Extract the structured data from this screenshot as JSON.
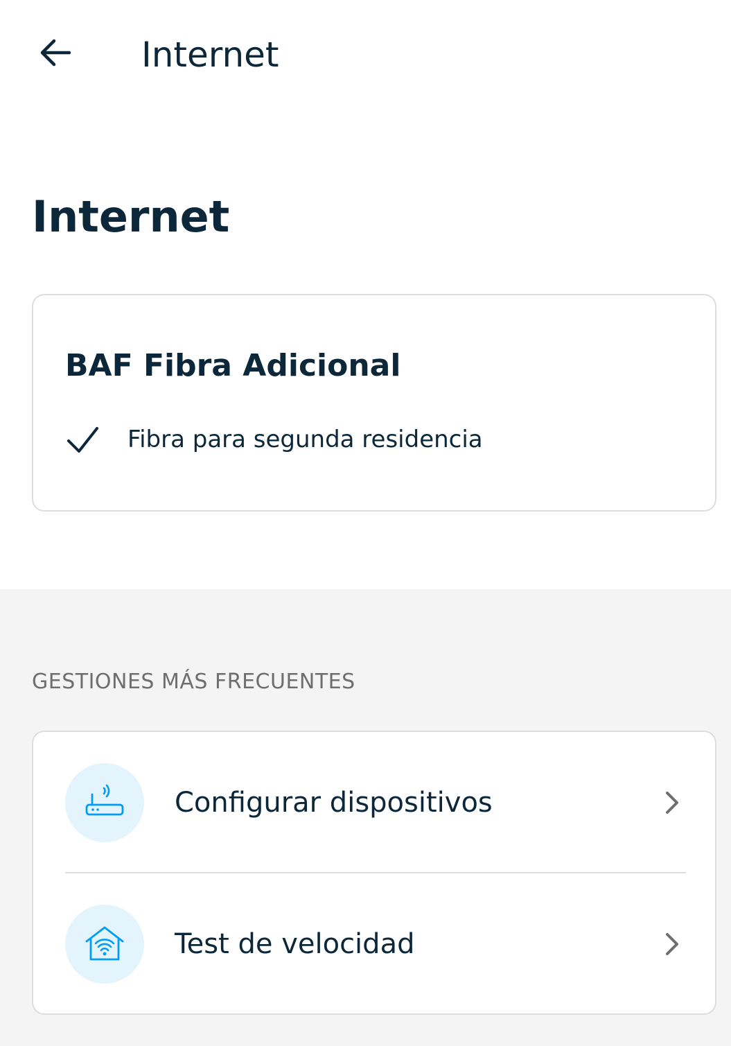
{
  "header": {
    "back_icon": "arrow-left-icon",
    "title": "Internet"
  },
  "page": {
    "title": "Internet"
  },
  "product_card": {
    "name": "BAF Fibra Adicional",
    "features": [
      {
        "icon": "check-icon",
        "text": "Fibra para segunda residencia"
      }
    ]
  },
  "frequent_actions": {
    "label": "GESTIONES MÁS FRECUENTES",
    "items": [
      {
        "icon": "router-icon",
        "label": "Configurar dispositivos",
        "chevron": "chevron-right-icon"
      },
      {
        "icon": "home-wifi-icon",
        "label": "Test de velocidad",
        "chevron": "chevron-right-icon"
      }
    ]
  },
  "colors": {
    "text_primary": "#0b2739",
    "section_background": "#f4f4f4",
    "icon_accent": "#019df4",
    "icon_circle": "#e3f4fc",
    "border": "#dddddd"
  }
}
